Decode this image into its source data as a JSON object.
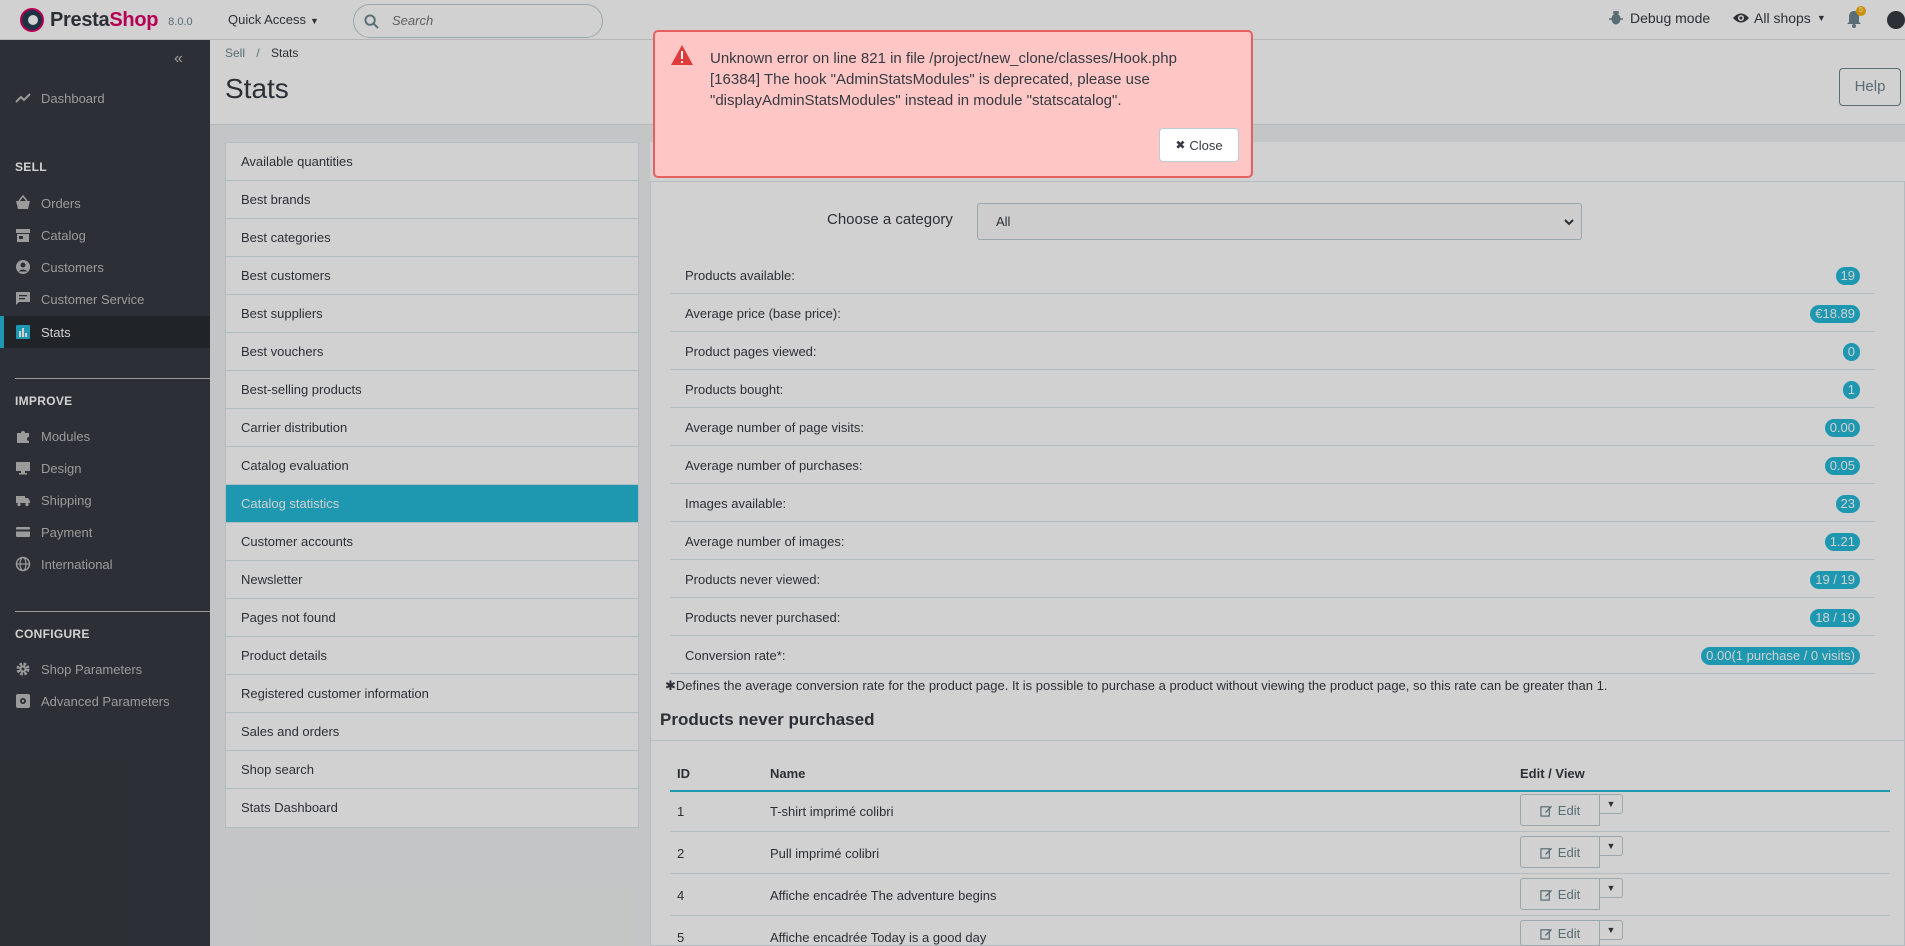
{
  "header": {
    "brand_prefix": "Presta",
    "brand_suffix": "Shop",
    "version": "8.0.0",
    "quick_access": "Quick Access",
    "search_placeholder": "Search",
    "debug_mode": "Debug mode",
    "all_shops": "All shops",
    "notifications_count": "5"
  },
  "sidebar": {
    "dashboard": "Dashboard",
    "sections": {
      "sell": "SELL",
      "improve": "IMPROVE",
      "configure": "CONFIGURE"
    },
    "sell_items": [
      "Orders",
      "Catalog",
      "Customers",
      "Customer Service",
      "Stats"
    ],
    "improve_items": [
      "Modules",
      "Design",
      "Shipping",
      "Payment",
      "International"
    ],
    "configure_items": [
      "Shop Parameters",
      "Advanced Parameters"
    ]
  },
  "page": {
    "breadcrumb_parent": "Sell",
    "breadcrumb_sep": "/",
    "breadcrumb_current": "Stats",
    "title": "Stats",
    "help": "Help"
  },
  "modules": [
    "Available quantities",
    "Best brands",
    "Best categories",
    "Best customers",
    "Best suppliers",
    "Best vouchers",
    "Best-selling products",
    "Carrier distribution",
    "Catalog evaluation",
    "Catalog statistics",
    "Customer accounts",
    "Newsletter",
    "Pages not found",
    "Product details",
    "Registered customer information",
    "Sales and orders",
    "Shop search",
    "Stats Dashboard"
  ],
  "active_module": "Catalog statistics",
  "catalog": {
    "category_label": "Choose a category",
    "category_value": "All",
    "stats": [
      {
        "label": "Products available:",
        "value": "19"
      },
      {
        "label": "Average price (base price):",
        "value": "€18.89"
      },
      {
        "label": "Product pages viewed:",
        "value": "0"
      },
      {
        "label": "Products bought:",
        "value": "1"
      },
      {
        "label": "Average number of page visits:",
        "value": "0.00"
      },
      {
        "label": "Average number of purchases:",
        "value": "0.05"
      },
      {
        "label": "Images available:",
        "value": "23"
      },
      {
        "label": "Average number of images:",
        "value": "1.21"
      },
      {
        "label": "Products never viewed:",
        "value": "19 / 19"
      },
      {
        "label": "Products never purchased:",
        "value": "18 / 19"
      },
      {
        "label": "Conversion rate*:",
        "value": "0.00(1 purchase / 0 visits)"
      }
    ],
    "footnote_mark": "✱",
    "footnote": "Defines the average conversion rate for the product page. It is possible to purchase a product without viewing the product page, so this rate can be greater than 1."
  },
  "never_purchased": {
    "title": "Products never purchased",
    "columns": [
      "ID",
      "Name",
      "Edit / View"
    ],
    "edit_label": "Edit",
    "rows": [
      {
        "id": "1",
        "name": "T-shirt imprimé colibri"
      },
      {
        "id": "2",
        "name": "Pull imprimé colibri"
      },
      {
        "id": "4",
        "name": "Affiche encadrée The adventure begins"
      },
      {
        "id": "5",
        "name": "Affiche encadrée Today is a good day"
      }
    ]
  },
  "alert": {
    "line1": "Unknown error on line 821 in file /project/new_clone/classes/Hook.php",
    "line2": "[16384] The hook \"AdminStatsModules\" is deprecated, please use",
    "line3": "\"displayAdminStatsModules\" instead in module \"statscatalog\".",
    "close": "Close"
  },
  "colors": {
    "accent": "#25b9d7",
    "sidebar_bg": "#363a41",
    "brand_pink": "#df0067",
    "alert_bg": "#ffc6c6",
    "alert_border": "#e66060"
  }
}
